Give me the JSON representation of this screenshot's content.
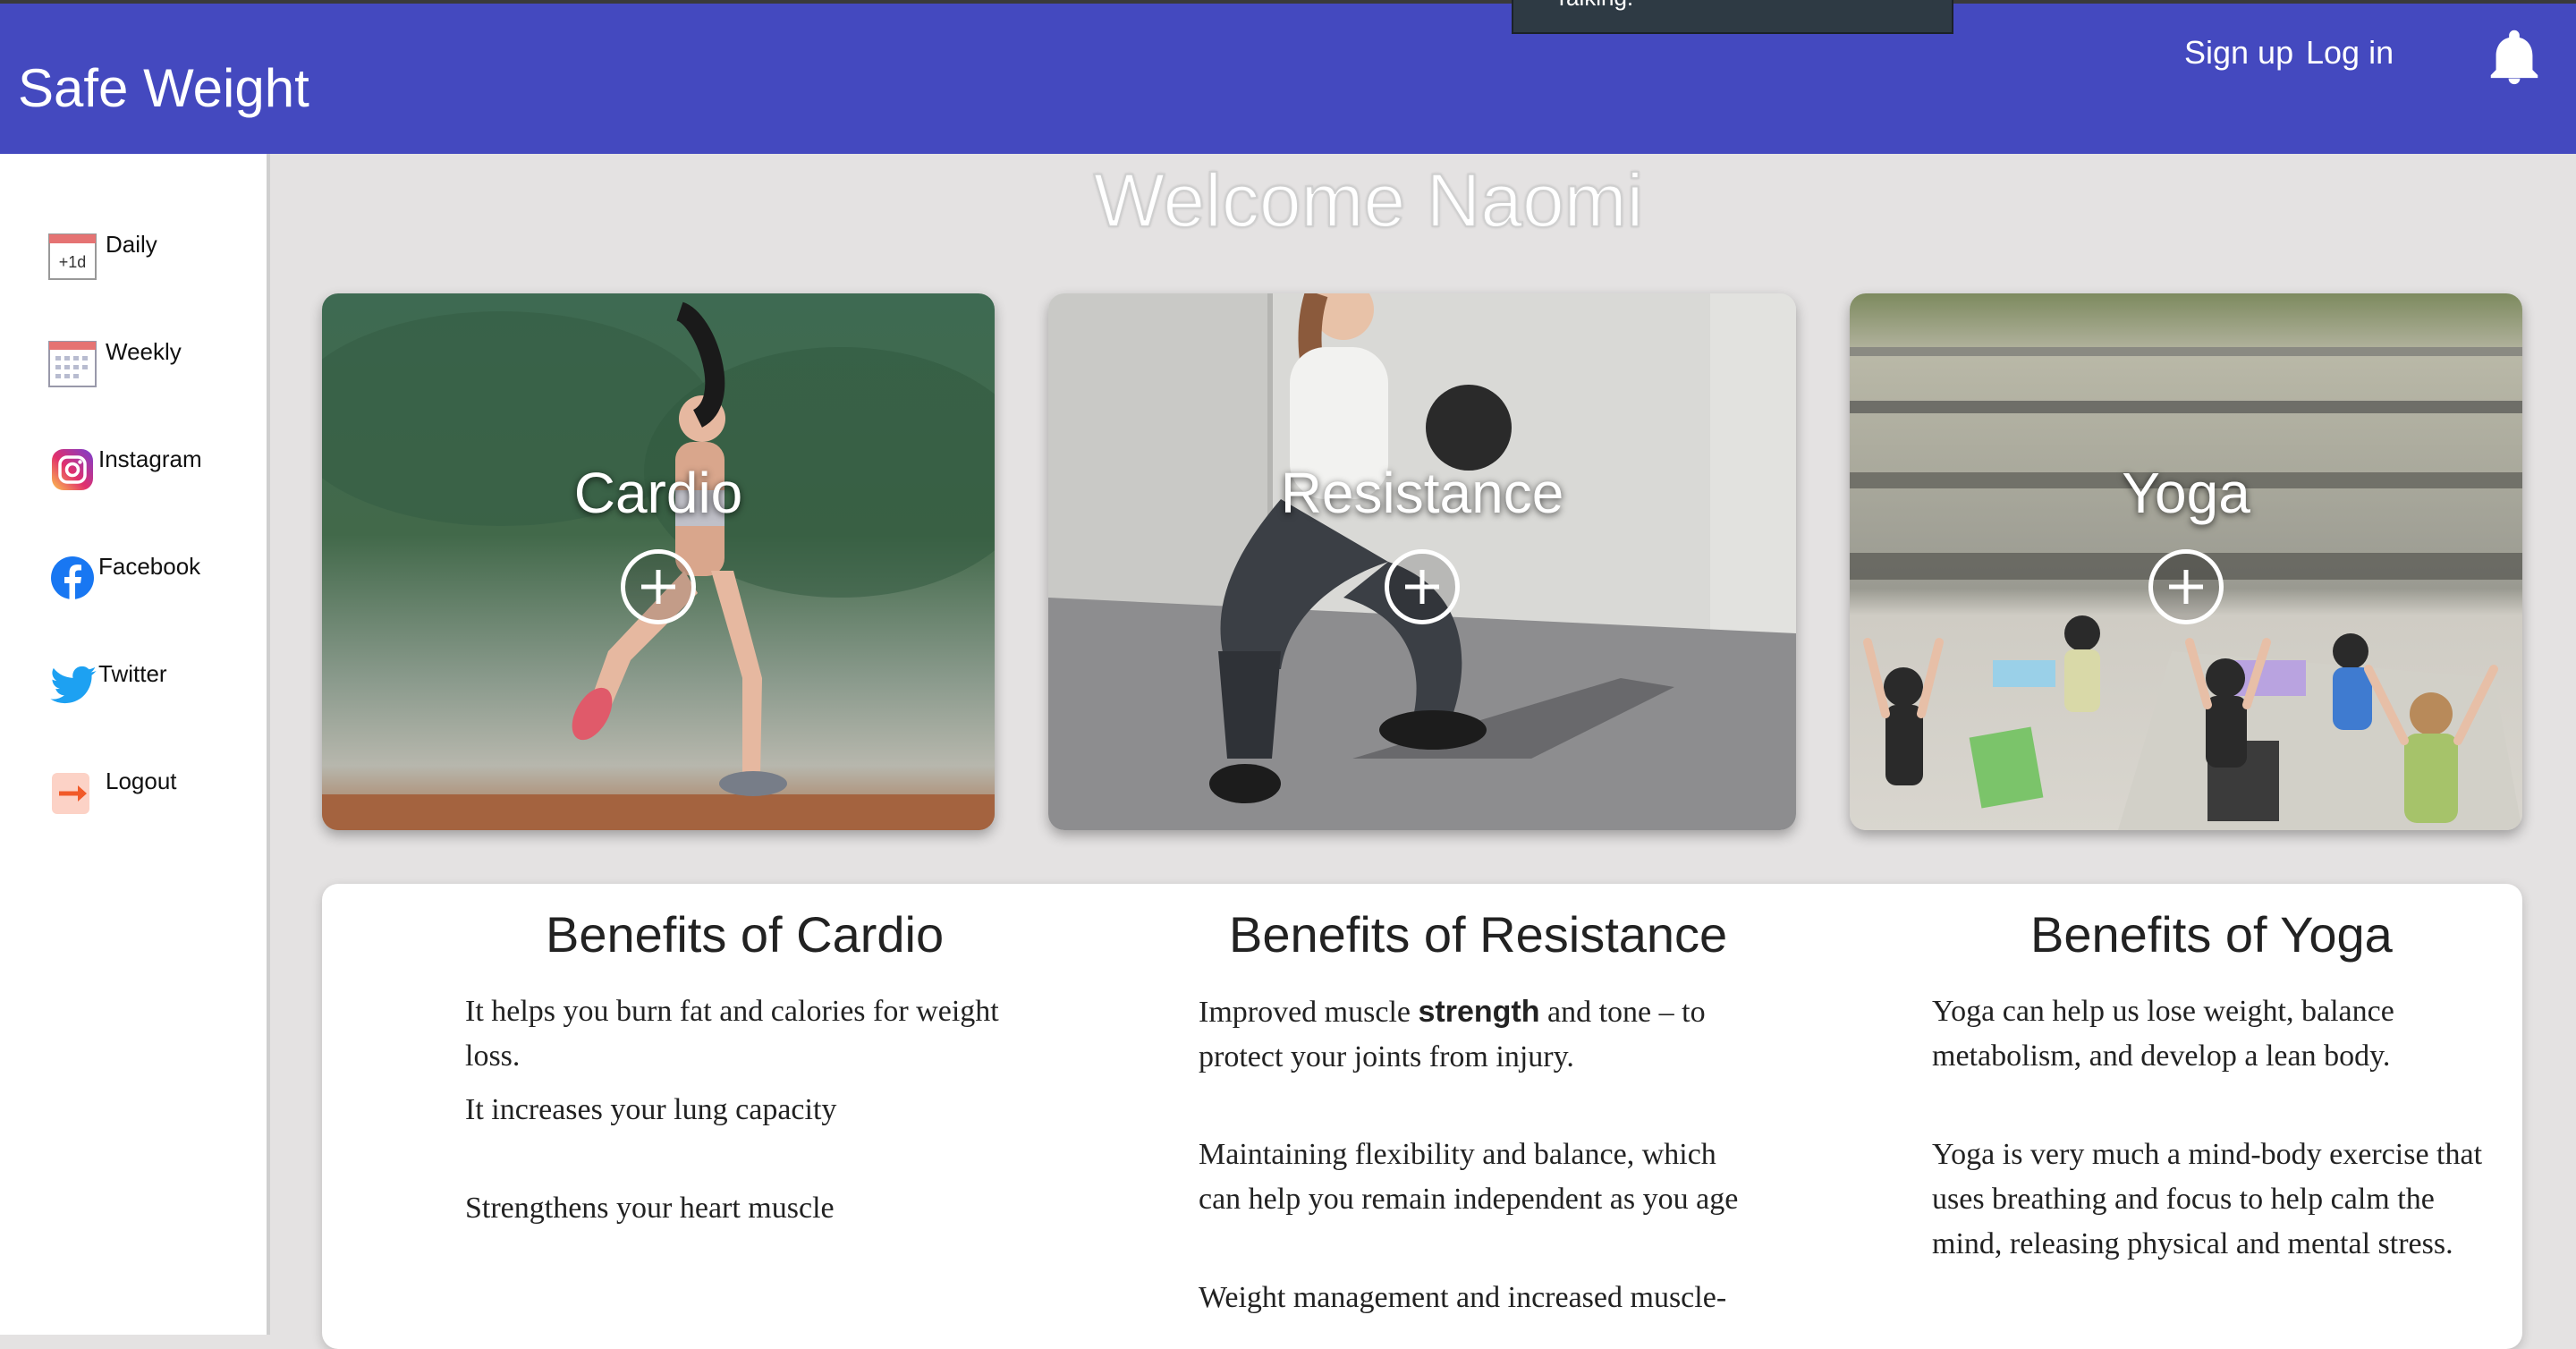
{
  "header": {
    "brand": "Safe Weight",
    "tooltip_text": "Talking.",
    "signup_label": "Sign up",
    "login_label": "Log in",
    "bell_icon": "bell-icon",
    "color": "#4449bf"
  },
  "sidebar": {
    "items": [
      {
        "label": "Daily",
        "icon": "daily-calendar-icon",
        "badge": "+1d"
      },
      {
        "label": "Weekly",
        "icon": "weekly-calendar-icon"
      },
      {
        "label": "Instagram",
        "icon": "instagram-icon"
      },
      {
        "label": "Facebook",
        "icon": "facebook-icon"
      },
      {
        "label": "Twitter",
        "icon": "twitter-icon"
      },
      {
        "label": "Logout",
        "icon": "logout-icon"
      }
    ]
  },
  "welcome": "Welcome Naomi",
  "cards": [
    {
      "title": "Cardio",
      "image": "woman running outdoors"
    },
    {
      "title": "Resistance",
      "image": "woman squatting with kettlebell"
    },
    {
      "title": "Yoga",
      "image": "group yoga class outdoors"
    }
  ],
  "benefits": [
    {
      "title": "Benefits of Cardio",
      "paragraphs": [
        "It helps you burn fat and calories for weight loss.",
        "It increases your lung capacity",
        "Strengthens your heart muscle"
      ]
    },
    {
      "title": "Benefits of Resistance",
      "p1_before": "Improved muscle ",
      "p1_bold": "strength",
      "p1_after": " and tone – to protect your joints from injury.",
      "paragraphs": [
        "Maintaining flexibility and balance, which can help you remain independent as you age",
        "Weight management and increased muscle-"
      ]
    },
    {
      "title": "Benefits of Yoga",
      "paragraphs": [
        "Yoga can help us lose weight, balance metabolism, and develop a lean body.",
        "Yoga is very much a mind-body exercise that uses breathing and focus to help calm the mind, releasing physical and mental stress."
      ]
    }
  ]
}
